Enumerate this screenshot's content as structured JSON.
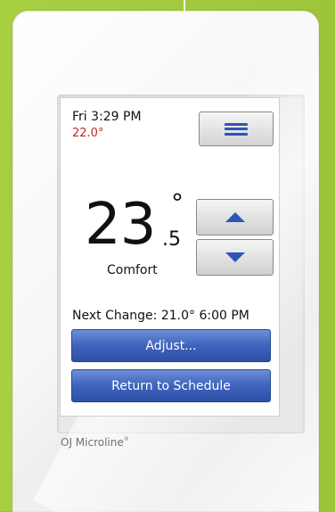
{
  "status": {
    "datetime": "Fri 3:29 PM",
    "floor_temp": "22.0°"
  },
  "display": {
    "temp_whole": "23",
    "temp_decimal": ".5",
    "degree_symbol": "°",
    "mode": "Comfort"
  },
  "next_change": {
    "text": "Next Change: 21.0°  6:00 PM"
  },
  "buttons": {
    "adjust": "Adjust...",
    "return": "Return to Schedule"
  },
  "branding": {
    "name": "OJ Microline",
    "mark": "®"
  },
  "icons": {
    "menu": "menu-icon",
    "up": "arrow-up-icon",
    "down": "arrow-down-icon"
  },
  "colors": {
    "background": "#9dc53a",
    "accent_blue": "#3f63bd",
    "floor_temp_red": "#c0262d"
  }
}
